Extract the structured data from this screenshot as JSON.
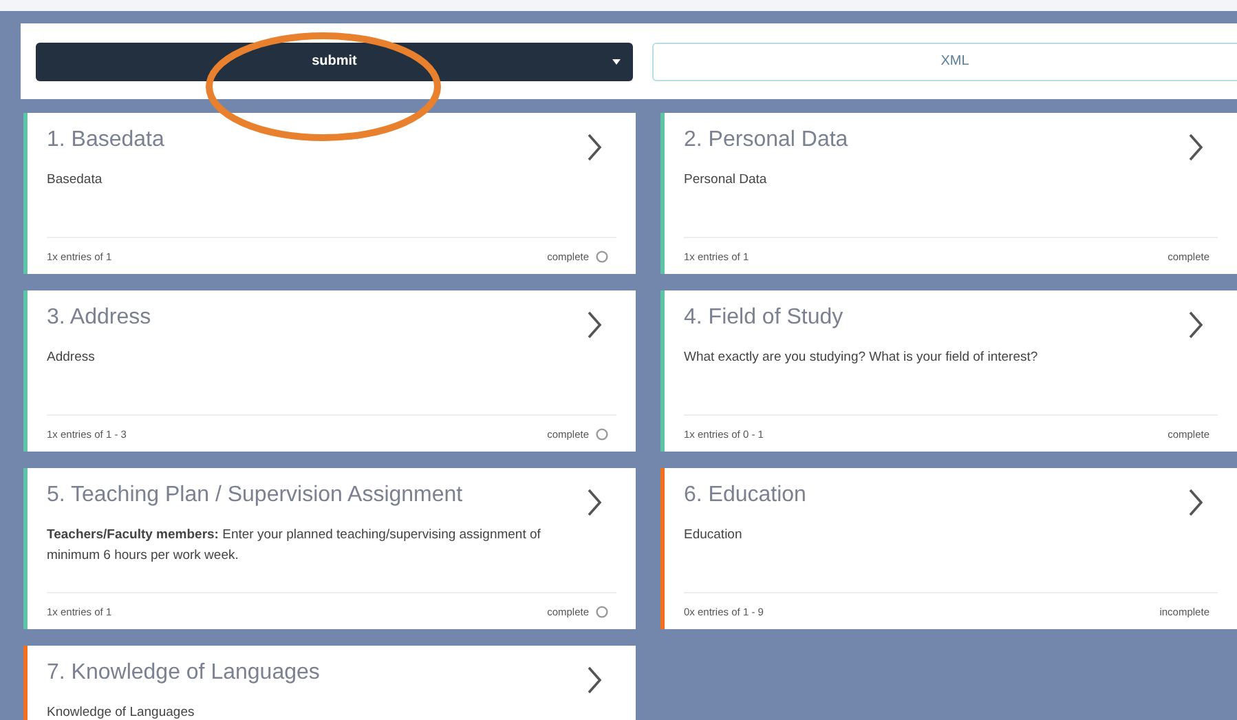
{
  "toolbar": {
    "submit": "submit",
    "xml": "XML"
  },
  "annotation": {
    "color": "#e8802e"
  },
  "cards": [
    {
      "title": "1. Basedata",
      "description": "Basedata",
      "entries": "1x entries of 1",
      "status": "complete",
      "complete": true,
      "status_icon": true
    },
    {
      "title": "2. Personal Data",
      "description": "Personal Data",
      "entries": "1x entries of 1",
      "status": "complete",
      "complete": true,
      "status_icon": false
    },
    {
      "title": "3. Address",
      "description": "Address",
      "entries": "1x entries of 1 - 3",
      "status": "complete",
      "complete": true,
      "status_icon": true
    },
    {
      "title": "4. Field of Study",
      "description": "What exactly are you studying? What is your field of interest?",
      "entries": "1x entries of 0 - 1",
      "status": "complete",
      "complete": true,
      "status_icon": false
    },
    {
      "title": "5. Teaching Plan / Supervision Assignment",
      "description": "**Teachers/Faculty members:** Enter your planned teaching/supervising assignment of minimum 6 hours per work week.",
      "entries": "1x entries of 1",
      "status": "complete",
      "complete": true,
      "status_icon": true
    },
    {
      "title": "6. Education",
      "description": "Education",
      "entries": "0x entries of 1 - 9",
      "status": "incomplete",
      "complete": false,
      "status_icon": false
    },
    {
      "title": "7. Knowledge of Languages",
      "description": "Knowledge of Languages",
      "complete": false
    }
  ]
}
